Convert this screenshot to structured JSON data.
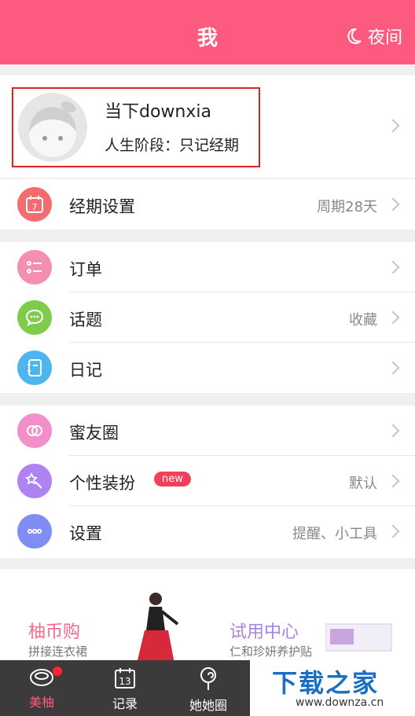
{
  "header": {
    "title": "我",
    "night_label": "夜间"
  },
  "profile": {
    "name": "当下downxia",
    "stage": "人生阶段：只记经期"
  },
  "period": {
    "label": "经期设置",
    "value": "周期28天",
    "calendar_day": "7"
  },
  "group1": [
    {
      "label": "订单",
      "value": ""
    },
    {
      "label": "话题",
      "value": "收藏"
    },
    {
      "label": "日记",
      "value": ""
    }
  ],
  "group2": [
    {
      "label": "蜜友圈",
      "value": ""
    },
    {
      "label": "个性装扮",
      "value": "默认",
      "badge": "new"
    },
    {
      "label": "设置",
      "value": "提醒、小工具"
    }
  ],
  "promo": {
    "left_title": "柚币购",
    "left_sub": "拼接连衣裙",
    "right_title": "试用中心",
    "right_sub": "仁和珍妍养护贴"
  },
  "tabs": [
    {
      "label": "美柚",
      "icon": "meiyou-bowl-icon"
    },
    {
      "label": "记录",
      "icon": "calendar-13-icon",
      "day": "13"
    },
    {
      "label": "她她圈",
      "icon": "lollipop-icon"
    }
  ],
  "watermark": {
    "title": "下载之家",
    "url": "www.downza.cn"
  },
  "colors": {
    "brand": "#fc5a7e",
    "red_icon": "#f36d70",
    "pink_icon": "#f38fb0",
    "green_icon": "#7fcc4a",
    "blue_icon": "#4db6ef",
    "purple_icon": "#ae82f0",
    "indigo_icon": "#7f8df4"
  }
}
